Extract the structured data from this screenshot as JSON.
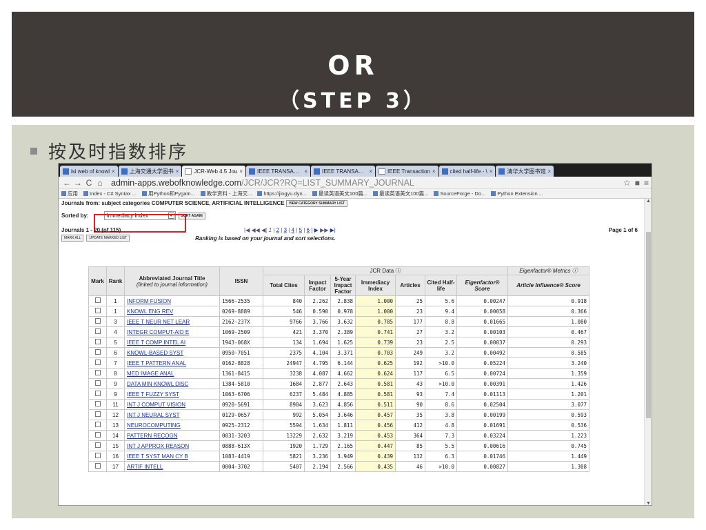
{
  "slide": {
    "title_line1": "OR",
    "title_line2": "（STEP 3）",
    "bullet": "按及时指数排序"
  },
  "browser": {
    "tabs": [
      {
        "label": "isi web of knowl"
      },
      {
        "label": "上海交通大学图书"
      },
      {
        "label": "JCR-Web 4.5 Jou"
      },
      {
        "label": "IEEE TRANSACTI"
      },
      {
        "label": "IEEE TRANSACTI"
      },
      {
        "label": "IEEE Transaction"
      },
      {
        "label": "cited half-life - \\"
      },
      {
        "label": "清华大学图书馆"
      }
    ],
    "url_host": "admin-apps.webofknowledge.com",
    "url_path": "/JCR/JCR?RQ=LIST_SUMMARY_JOURNAL",
    "bookmarks": [
      "应用",
      "Index - C# Syntax ...",
      "用Python和Pygam...",
      "教学资料 - 上海交...",
      "https://jingyu.dyn...",
      "最读英语美文100篇...",
      "最读英语美文100篇...",
      "SourceForge - Do...",
      "Python Extension ..."
    ]
  },
  "jcr": {
    "journals_from_label": "Journals from:",
    "subject_label": "subject categories COMPUTER SCIENCE, ARTIFICIAL INTELLIGENCE",
    "view_category_btn": "VIEW CATEGORY SUMMARY LIST",
    "sorted_by_label": "Sorted by:",
    "sort_value": "Immediacy Index",
    "sort_again_btn": "SORT AGAIN",
    "journals_range": "Journals 1 - 20 (of 115)",
    "pager_pages": [
      "1",
      "2",
      "3",
      "4",
      "5",
      "6"
    ],
    "page_of": "Page 1 of 6",
    "mark_all_btn": "MARK ALL",
    "update_marked_btn": "UPDATE MARKED LIST",
    "ranking_note": "Ranking is based on your journal and sort selections.",
    "headers": {
      "mark": "Mark",
      "rank": "Rank",
      "title": "Abbreviated Journal Title",
      "title_sub": "(linked to journal information)",
      "issn": "ISSN",
      "jcr_group": "JCR Data",
      "eigen_group": "Eigenfactor® Metrics",
      "total_cites": "Total Cites",
      "impact": "Impact Factor",
      "five_year": "5-Year Impact Factor",
      "immediacy": "Immediacy Index",
      "articles": "Articles",
      "half_life": "Cited Half-life",
      "eigen_score": "Eigenfactor® Score",
      "ai_score": "Article Influence® Score"
    },
    "rows": [
      {
        "rank": "1",
        "title": "INFORM FUSION",
        "issn": "1566-2535",
        "cites": "840",
        "if": "2.262",
        "if5": "2.838",
        "imm": "1.000",
        "art": "25",
        "hl": "5.6",
        "ef": "0.00247",
        "ai": "0.918"
      },
      {
        "rank": "1",
        "title": "KNOWL ENG REV",
        "issn": "0269-8889",
        "cites": "546",
        "if": "0.590",
        "if5": "0.978",
        "imm": "1.000",
        "art": "23",
        "hl": "9.4",
        "ef": "0.00058",
        "ai": "0.366"
      },
      {
        "rank": "3",
        "title": "IEEE T NEUR NET LEAR",
        "issn": "2162-237X",
        "cites": "9766",
        "if": "3.766",
        "if5": "3.632",
        "imm": "0.785",
        "art": "177",
        "hl": "8.8",
        "ef": "0.01665",
        "ai": "1.080"
      },
      {
        "rank": "4",
        "title": "INTEGR COMPUT-AID E",
        "issn": "1069-2509",
        "cites": "421",
        "if": "3.370",
        "if5": "2.389",
        "imm": "0.741",
        "art": "27",
        "hl": "3.2",
        "ef": "0.00103",
        "ai": "0.467"
      },
      {
        "rank": "5",
        "title": "IEEE T COMP INTEL AI",
        "issn": "1943-068X",
        "cites": "134",
        "if": "1.694",
        "if5": "1.625",
        "imm": "0.739",
        "art": "23",
        "hl": "2.5",
        "ef": "0.00037",
        "ai": "0.293"
      },
      {
        "rank": "6",
        "title": "KNOWL-BASED SYST",
        "issn": "0950-7051",
        "cites": "2375",
        "if": "4.104",
        "if5": "3.371",
        "imm": "0.703",
        "art": "249",
        "hl": "3.2",
        "ef": "0.00492",
        "ai": "0.585"
      },
      {
        "rank": "7",
        "title": "IEEE T PATTERN ANAL",
        "issn": "0162-8828",
        "cites": "24947",
        "if": "4.795",
        "if5": "6.144",
        "imm": "0.625",
        "art": "192",
        "hl": ">10.0",
        "ef": "0.05224",
        "ai": "3.240"
      },
      {
        "rank": "8",
        "title": "MED IMAGE ANAL",
        "issn": "1361-8415",
        "cites": "3238",
        "if": "4.087",
        "if5": "4.662",
        "imm": "0.624",
        "art": "117",
        "hl": "6.5",
        "ef": "0.00724",
        "ai": "1.359"
      },
      {
        "rank": "9",
        "title": "DATA MIN KNOWL DISC",
        "issn": "1384-5810",
        "cites": "1684",
        "if": "2.877",
        "if5": "2.643",
        "imm": "0.581",
        "art": "43",
        "hl": ">10.0",
        "ef": "0.00391",
        "ai": "1.426"
      },
      {
        "rank": "9",
        "title": "IEEE T FUZZY SYST",
        "issn": "1063-6706",
        "cites": "6237",
        "if": "5.484",
        "if5": "4.885",
        "imm": "0.581",
        "art": "93",
        "hl": "7.4",
        "ef": "0.01113",
        "ai": "1.201"
      },
      {
        "rank": "11",
        "title": "INT J COMPUT VISION",
        "issn": "0920-5691",
        "cites": "8984",
        "if": "3.623",
        "if5": "4.856",
        "imm": "0.511",
        "art": "90",
        "hl": "8.6",
        "ef": "0.02504",
        "ai": "3.077"
      },
      {
        "rank": "12",
        "title": "INT J NEURAL SYST",
        "issn": "0129-0657",
        "cites": "992",
        "if": "5.054",
        "if5": "3.646",
        "imm": "0.457",
        "art": "35",
        "hl": "3.8",
        "ef": "0.00199",
        "ai": "0.593"
      },
      {
        "rank": "13",
        "title": "NEUROCOMPUTING",
        "issn": "0925-2312",
        "cites": "5594",
        "if": "1.634",
        "if5": "1.811",
        "imm": "0.456",
        "art": "412",
        "hl": "4.8",
        "ef": "0.01691",
        "ai": "0.536"
      },
      {
        "rank": "14",
        "title": "PATTERN RECOGN",
        "issn": "0031-3203",
        "cites": "13229",
        "if": "2.632",
        "if5": "3.219",
        "imm": "0.453",
        "art": "364",
        "hl": "7.3",
        "ef": "0.03224",
        "ai": "1.223"
      },
      {
        "rank": "15",
        "title": "INT J APPROX REASON",
        "issn": "0888-613X",
        "cites": "1920",
        "if": "1.729",
        "if5": "2.165",
        "imm": "0.447",
        "art": "85",
        "hl": "5.5",
        "ef": "0.00616",
        "ai": "0.745"
      },
      {
        "rank": "16",
        "title": "IEEE T SYST MAN CY B",
        "issn": "1083-4419",
        "cites": "5821",
        "if": "3.236",
        "if5": "3.949",
        "imm": "0.439",
        "art": "132",
        "hl": "6.3",
        "ef": "0.01746",
        "ai": "1.449"
      },
      {
        "rank": "17",
        "title": "ARTIF INTELL",
        "issn": "0004-3702",
        "cites": "5407",
        "if": "2.194",
        "if5": "2.566",
        "imm": "0.435",
        "art": "46",
        "hl": ">10.0",
        "ef": "0.00827",
        "ai": "1.308"
      }
    ]
  }
}
